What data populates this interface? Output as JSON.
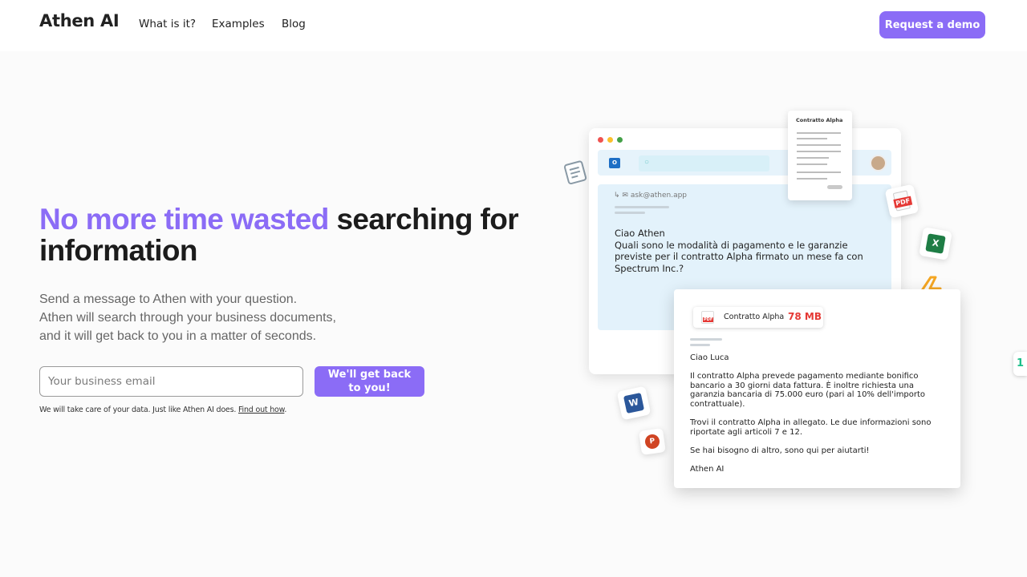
{
  "brand": {
    "name": "Athen AI",
    "accent_color": "#8b6cf6"
  },
  "nav": {
    "links": [
      "What is it?",
      "Examples",
      "Blog"
    ],
    "cta_label": "Request a demo"
  },
  "hero": {
    "headline_accent": "No more time wasted",
    "headline_rest": " searching for information",
    "subtext_lines": [
      "Send a message to Athen with your question.",
      "Athen will search through your business documents,",
      "and it will get back to you in a matter of seconds."
    ],
    "email_placeholder": "Your business email",
    "submit_label": "We'll get back to you!",
    "privacy_text": "We will take care of your data. Just like Athen AI does. ",
    "privacy_link": "Find out how"
  },
  "illustration": {
    "doc_card_title": "Contratto Alpha",
    "from_address": "ask@athen.app",
    "question_greeting": "Ciao Athen",
    "question_text": "Quali sono le modalità di pagamento e le garanzie previste per il contratto Alpha firmato un mese fa con Spectrum Inc.?",
    "attachment_name": "Contratto Alpha",
    "attachment_size": "78 MB",
    "pdf_label": "PDF",
    "reply_greeting": "Ciao Luca",
    "reply_paragraph_1": "Il contratto Alpha prevede pagamento mediante bonifico bancario a 30 giorni data fattura. È inoltre richiesta una garanzia bancaria di 75.000 euro (pari al 10% dell'importo contrattuale).",
    "reply_paragraph_2": "Trovi il contratto Alpha in allegato. Le due informazioni sono riportate agli articoli 7 e 12.",
    "reply_paragraph_3": "Se hai bisogno di altro, sono qui per aiutarti!",
    "reply_signature": "Athen AI",
    "icons": {
      "outlook": "O",
      "excel": "X",
      "word": "W",
      "powerpoint": "P",
      "edge_badge": "1"
    },
    "colors": {
      "pdf_red": "#e53935",
      "excel_green": "#1e7d45",
      "word_blue": "#2b579a",
      "powerpoint_orange": "#d04423",
      "lightning": "#f4a623"
    }
  }
}
